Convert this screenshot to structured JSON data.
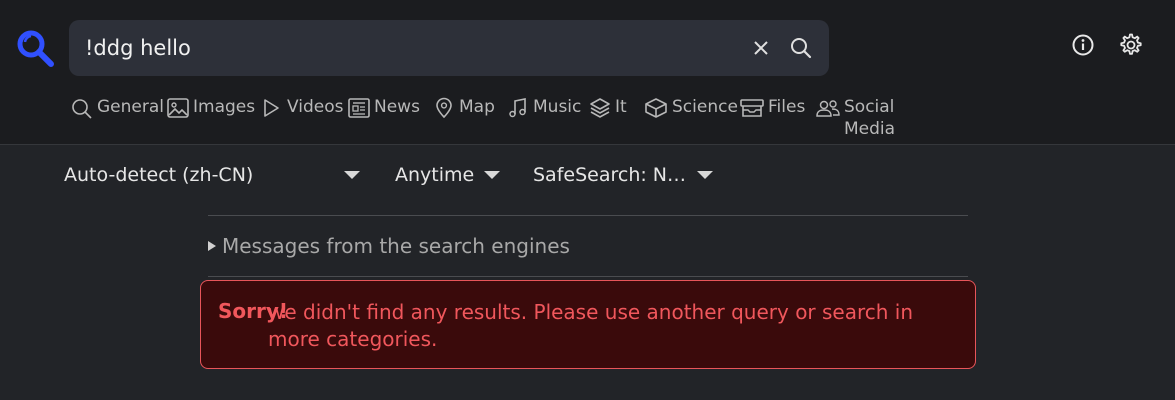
{
  "search": {
    "query": "!ddg hello",
    "logo_icon": "magnifier-logo-icon",
    "clear_icon": "close-icon",
    "submit_icon": "search-icon"
  },
  "header_actions": {
    "info_icon": "info-icon",
    "settings_icon": "gear-icon"
  },
  "categories": [
    {
      "label": "General",
      "icon": "search-icon"
    },
    {
      "label": "Images",
      "icon": "image-icon"
    },
    {
      "label": "Videos",
      "icon": "play-icon"
    },
    {
      "label": "News",
      "icon": "newspaper-icon"
    },
    {
      "label": "Map",
      "icon": "map-pin-icon"
    },
    {
      "label": "Music",
      "icon": "music-note-icon"
    },
    {
      "label": "It",
      "icon": "layers-icon"
    },
    {
      "label": "Science",
      "icon": "cube-icon"
    },
    {
      "label": "Files",
      "icon": "archive-icon"
    },
    {
      "label": "Social Media",
      "line1": "Social",
      "line2": "Media",
      "icon": "people-icon"
    }
  ],
  "filters": {
    "language": "Auto-detect (zh-CN)",
    "time": "Anytime",
    "safesearch": "SafeSearch: N…"
  },
  "messages_label": "Messages from the search engines",
  "alert": {
    "title": "Sorry!",
    "message": "we didn't find any results. Please use another query or search in more categories."
  },
  "colors": {
    "accent": "#3050ff",
    "error_text": "#f0575c",
    "error_bg": "#3a0a0b"
  }
}
